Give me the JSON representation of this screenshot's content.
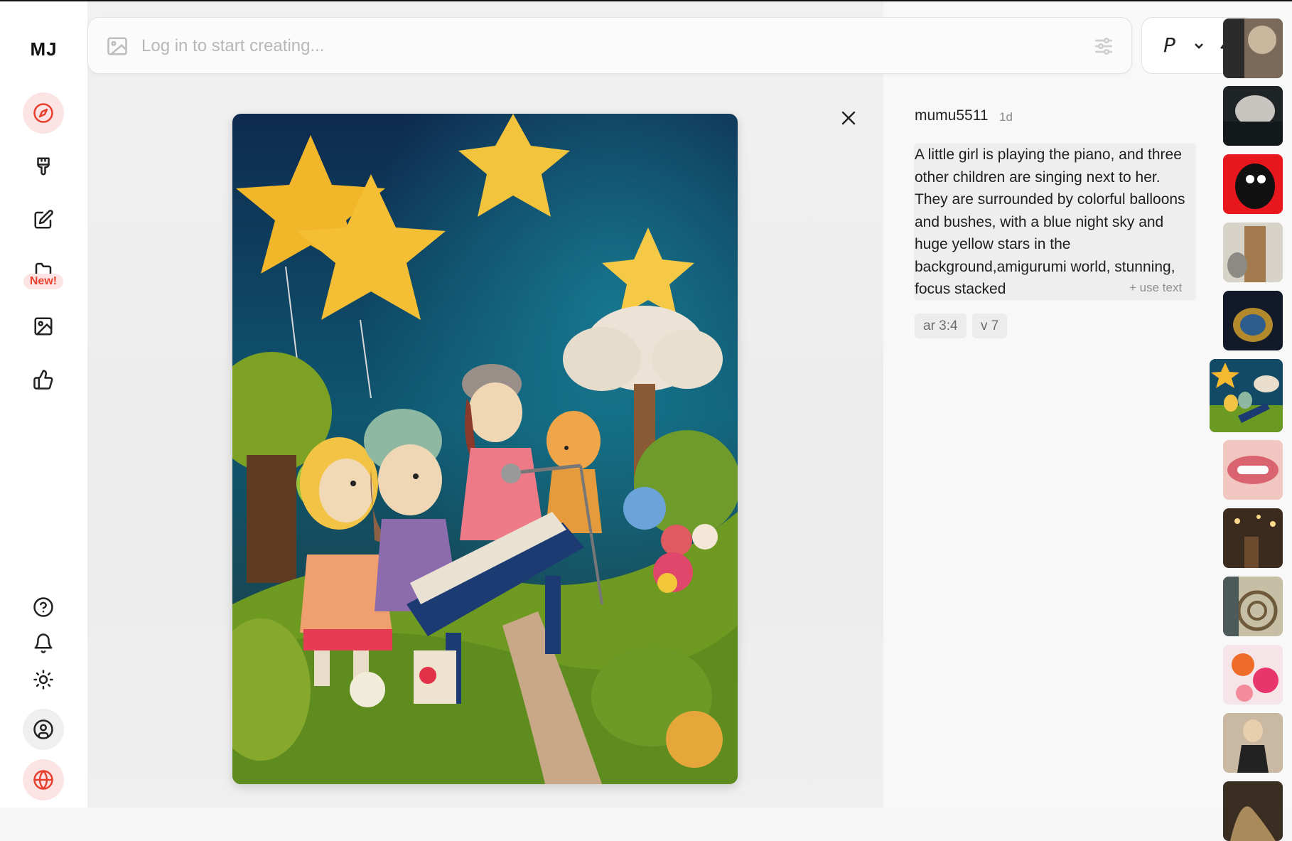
{
  "app": {
    "logo": "MJ"
  },
  "sidebar": {
    "items": [
      {
        "name": "explore",
        "icon": "compass-icon",
        "active": true
      },
      {
        "name": "create",
        "icon": "paintbrush-icon"
      },
      {
        "name": "edit",
        "icon": "edit-icon"
      },
      {
        "name": "new-feature",
        "icon": "folder-icon",
        "badge": "New!"
      },
      {
        "name": "organize",
        "icon": "image-icon"
      },
      {
        "name": "rank",
        "icon": "thumbs-up-icon"
      }
    ],
    "bottom": [
      {
        "name": "help",
        "icon": "help-icon"
      },
      {
        "name": "notifications",
        "icon": "bell-icon"
      },
      {
        "name": "theme",
        "icon": "sun-icon"
      },
      {
        "name": "account",
        "icon": "user-circle-icon"
      },
      {
        "name": "language",
        "icon": "globe-icon"
      }
    ]
  },
  "prompt_bar": {
    "placeholder": "Log in to start creating...",
    "mode_label": "P"
  },
  "detail": {
    "author": "mumu5511",
    "age": "1d",
    "prompt": "A little girl is playing the piano, and three other children are singing next to her. They are surrounded by colorful balloons and bushes, with a blue night sky and huge yellow stars in the background,amigurumi world, stunning, focus stacked",
    "use_text": "+ use text",
    "params": [
      "ar 3:4",
      "v 7"
    ]
  },
  "thumbnails": [
    {
      "name": "thumb-dog"
    },
    {
      "name": "thumb-dark-figure"
    },
    {
      "name": "thumb-black-cat"
    },
    {
      "name": "thumb-wolf-fashion"
    },
    {
      "name": "thumb-jewel"
    },
    {
      "name": "thumb-amigurumi",
      "active": true
    },
    {
      "name": "thumb-lips"
    },
    {
      "name": "thumb-party"
    },
    {
      "name": "thumb-abstract"
    },
    {
      "name": "thumb-flowers"
    },
    {
      "name": "thumb-woman"
    },
    {
      "name": "thumb-gold"
    }
  ],
  "colors": {
    "accent": "#e8402f",
    "accent_bg": "#fde4e4"
  }
}
